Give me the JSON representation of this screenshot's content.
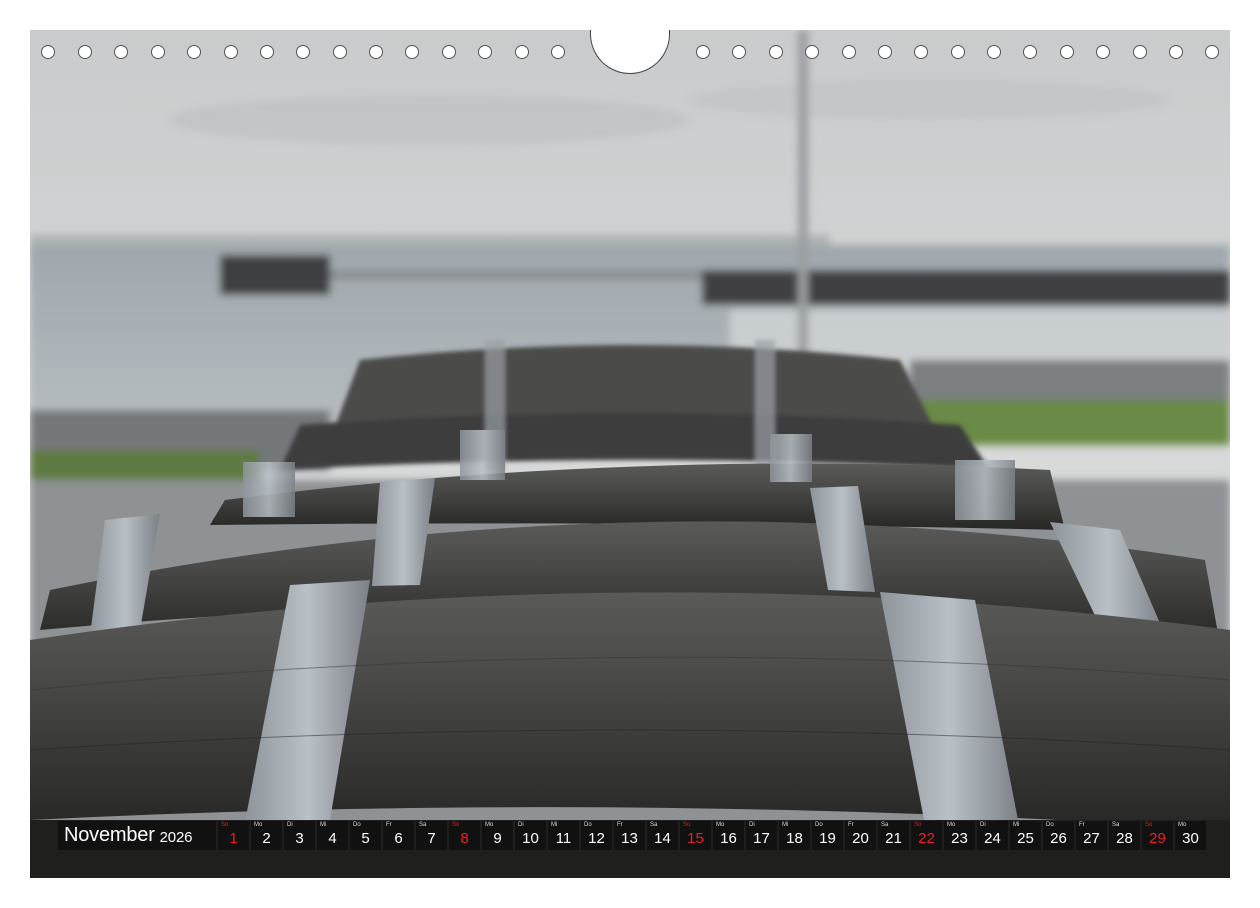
{
  "calendar": {
    "month": "November",
    "year": "2026",
    "days": [
      {
        "dn": "So",
        "num": "1",
        "sunday": true
      },
      {
        "dn": "Mo",
        "num": "2",
        "sunday": false
      },
      {
        "dn": "Di",
        "num": "3",
        "sunday": false
      },
      {
        "dn": "Mi",
        "num": "4",
        "sunday": false
      },
      {
        "dn": "Do",
        "num": "5",
        "sunday": false
      },
      {
        "dn": "Fr",
        "num": "6",
        "sunday": false
      },
      {
        "dn": "Sa",
        "num": "7",
        "sunday": false
      },
      {
        "dn": "So",
        "num": "8",
        "sunday": true
      },
      {
        "dn": "Mo",
        "num": "9",
        "sunday": false
      },
      {
        "dn": "Di",
        "num": "10",
        "sunday": false
      },
      {
        "dn": "Mi",
        "num": "11",
        "sunday": false
      },
      {
        "dn": "Do",
        "num": "12",
        "sunday": false
      },
      {
        "dn": "Fr",
        "num": "13",
        "sunday": false
      },
      {
        "dn": "Sa",
        "num": "14",
        "sunday": false
      },
      {
        "dn": "So",
        "num": "15",
        "sunday": true
      },
      {
        "dn": "Mo",
        "num": "16",
        "sunday": false
      },
      {
        "dn": "Di",
        "num": "17",
        "sunday": false
      },
      {
        "dn": "Mi",
        "num": "18",
        "sunday": false
      },
      {
        "dn": "Do",
        "num": "19",
        "sunday": false
      },
      {
        "dn": "Fr",
        "num": "20",
        "sunday": false
      },
      {
        "dn": "Sa",
        "num": "21",
        "sunday": false
      },
      {
        "dn": "So",
        "num": "22",
        "sunday": true
      },
      {
        "dn": "Mo",
        "num": "23",
        "sunday": false
      },
      {
        "dn": "Di",
        "num": "24",
        "sunday": false
      },
      {
        "dn": "Mi",
        "num": "25",
        "sunday": false
      },
      {
        "dn": "Do",
        "num": "26",
        "sunday": false
      },
      {
        "dn": "Fr",
        "num": "27",
        "sunday": false
      },
      {
        "dn": "Sa",
        "num": "28",
        "sunday": false
      },
      {
        "dn": "So",
        "num": "29",
        "sunday": true
      },
      {
        "dn": "Mo",
        "num": "30",
        "sunday": false
      }
    ]
  },
  "colors": {
    "sunday": "#e8202a",
    "strip": "#111111"
  }
}
